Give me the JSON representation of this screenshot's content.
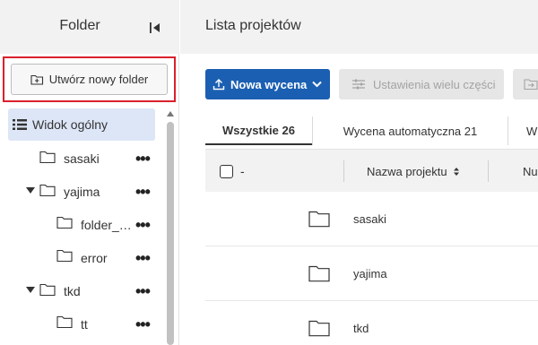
{
  "sidebar": {
    "title": "Folder",
    "create_button": "Utwórz nowy folder",
    "overview_label": "Widok ogólny",
    "items": [
      {
        "label": "sasaki",
        "expanded": false,
        "level": 0
      },
      {
        "label": "yajima",
        "expanded": true,
        "level": 0
      },
      {
        "label": "folder_…",
        "expanded": false,
        "level": 1
      },
      {
        "label": "error",
        "expanded": false,
        "level": 1
      },
      {
        "label": "tkd",
        "expanded": true,
        "level": 0
      },
      {
        "label": "tt",
        "expanded": false,
        "level": 1
      }
    ],
    "more_glyph": "•••"
  },
  "main": {
    "title": "Lista projektów",
    "toolbar": {
      "new_quote": "Nowa wycena",
      "multi_settings": "Ustawienia wielu części"
    },
    "tabs": [
      {
        "label": "Wszystkie 26",
        "active": true
      },
      {
        "label": "Wycena automatyczna 21",
        "active": false
      },
      {
        "label": "W",
        "active": false
      }
    ],
    "table": {
      "select_label": "-",
      "col_name": "Nazwa projektu",
      "col_num": "Nu",
      "rows": [
        {
          "name": "sasaki"
        },
        {
          "name": "yajima"
        },
        {
          "name": "tkd"
        }
      ]
    }
  },
  "colors": {
    "primary": "#1b5fb2",
    "highlight_border": "#d9212b",
    "selected_bg": "#dde6f7"
  }
}
